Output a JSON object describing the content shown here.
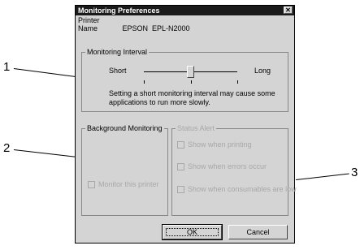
{
  "dialog": {
    "title": "Monitoring Preferences",
    "close_glyph": "✕",
    "printer_name_label": "Printer Name",
    "printer_name_value": "EPSON  EPL-N2000"
  },
  "monitoring_interval": {
    "group_title": "Monitoring Interval",
    "short_label": "Short",
    "long_label": "Long",
    "note_line1": "Setting a short monitoring interval may cause some",
    "note_line2": "applications to run more slowly.",
    "slider_position_fraction": 0.5
  },
  "background_monitoring": {
    "group_title": "Background Monitoring",
    "monitor_printer_label": "Monitor this printer"
  },
  "status_alert": {
    "group_title": "Status Alert",
    "show_printing": "Show when printing",
    "show_errors": "Show when errors occur",
    "show_consumables": "Show when consumables are low"
  },
  "buttons": {
    "ok": "OK",
    "cancel": "Cancel"
  },
  "callouts": {
    "one": "1",
    "two": "2",
    "three": "3"
  }
}
